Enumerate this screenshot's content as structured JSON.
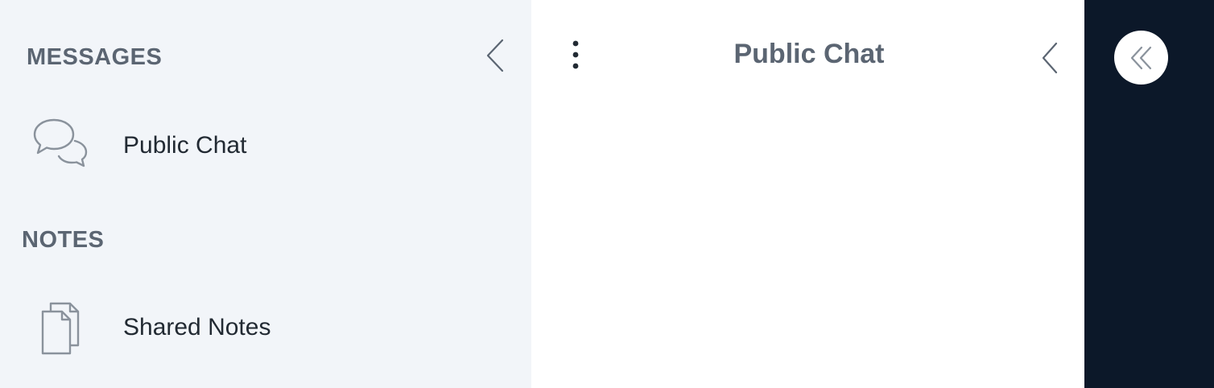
{
  "sidebar": {
    "messages_title": "MESSAGES",
    "notes_title": "NOTES",
    "items": [
      {
        "label": "Public Chat",
        "icon": "chat-bubbles-icon"
      },
      {
        "label": "Shared Notes",
        "icon": "documents-icon"
      }
    ]
  },
  "chat": {
    "title": "Public Chat"
  },
  "colors": {
    "sidebar_bg": "#f2f5f9",
    "panel_bg": "#ffffff",
    "rail_bg": "#0c1829",
    "section_text": "#5b6572",
    "item_text": "#222a33",
    "icon_stroke": "#8a929c"
  }
}
